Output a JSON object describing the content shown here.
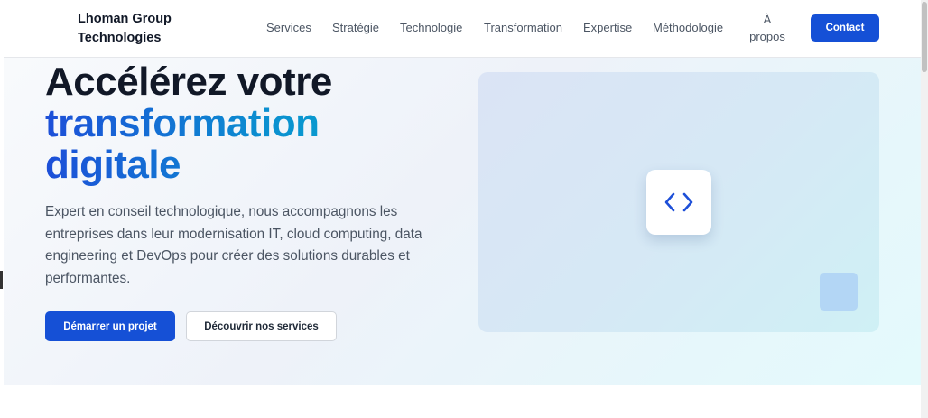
{
  "brand": {
    "name": "Lhoman Group Technologies"
  },
  "nav": {
    "items": [
      {
        "label": "Services"
      },
      {
        "label": "Stratégie"
      },
      {
        "label": "Technologie"
      },
      {
        "label": "Transformation"
      },
      {
        "label": "Expertise"
      },
      {
        "label": "Méthodologie"
      },
      {
        "label": "À propos"
      }
    ],
    "contact_label": "Contact"
  },
  "hero": {
    "title_line1": "Accélérez votre",
    "title_line2": "transformation",
    "title_line3": "digitale",
    "description": "Expert en conseil technologique, nous accompagnons les entreprises dans leur modernisation IT, cloud computing, data engineering et DevOps pour créer des solutions durables et performantes.",
    "primary_cta": "Démarrer un projet",
    "secondary_cta": "Découvrir nos services",
    "illustration_icon": "code-brackets-icon"
  },
  "colors": {
    "accent": "#1550d6",
    "gradient_start": "#1d4fd8",
    "gradient_end": "#08aecd",
    "heading": "#111827",
    "body_text": "#4b5563"
  }
}
